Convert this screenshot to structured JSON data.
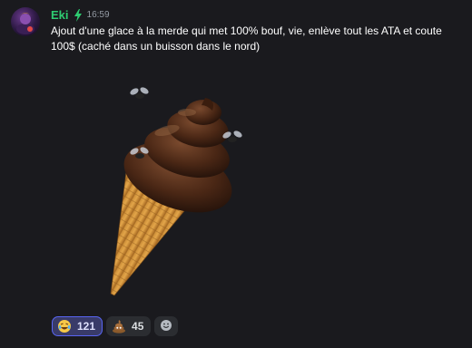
{
  "message": {
    "author": "Eki",
    "timestamp": "16:59",
    "text": "Ajout d'une glace à la merde qui met 100% bouf, vie, enlève tout les ATA et coute 100$ (caché dans un buisson dans le nord)",
    "author_color": "#2ecc71",
    "badge_icon": "lightning-bolt-icon",
    "attachment": "ice-cream-cone-with-flies-image"
  },
  "reactions": [
    {
      "emoji": "rolling-on-floor-laughing-emoji",
      "count": "121",
      "active": true
    },
    {
      "emoji": "pile-of-poo-emoji",
      "count": "45",
      "active": false
    }
  ],
  "add_reaction_icon": "add-reaction-smiley-icon"
}
